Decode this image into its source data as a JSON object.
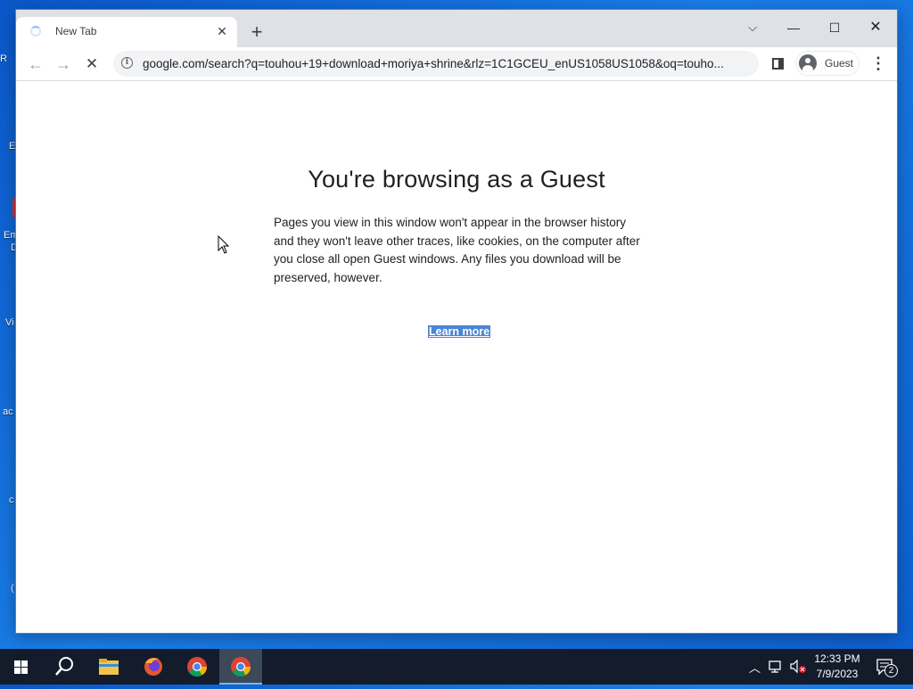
{
  "browser": {
    "tab": {
      "title": "New Tab",
      "close_symbol": "✕"
    },
    "new_tab_symbol": "+",
    "window_controls": {
      "tab_search": "⌵",
      "minimize": "—",
      "maximize": "☐",
      "close": "✕"
    },
    "toolbar": {
      "back_symbol": "←",
      "forward_symbol": "→",
      "stop_symbol": "✕",
      "info_symbol": "i",
      "url": "google.com/search?q=touhou+19+download+moriya+shrine&rlz=1C1GCEU_enUS1058US1058&oq=touho...",
      "profile_label": "Guest",
      "menu_symbol": "⋮"
    },
    "page": {
      "heading": "You're browsing as a Guest",
      "body": "Pages you view in this window won't appear in the browser history and they won't leave other traces, like cookies, on the computer after you close all open Guest windows. Any files you download will be preserved, however.",
      "link": "Learn more"
    }
  },
  "desktop": {
    "partial_labels": [
      "R",
      "E",
      "Em",
      "D",
      "Vi",
      "ac",
      "c",
      "("
    ]
  },
  "taskbar": {
    "items": [
      "start-icon",
      "search-icon",
      "file-explorer-icon",
      "firefox-icon",
      "chrome-icon",
      "chrome-icon"
    ],
    "clock_time": "12:33 PM",
    "clock_date": "7/9/2023",
    "notification_count": "2"
  },
  "colors": {
    "desktop_blue": "#1a7ee8",
    "tabstrip": "#dee1e6",
    "taskbar": "#141c2c",
    "link_highlight": "#4a86d6"
  }
}
